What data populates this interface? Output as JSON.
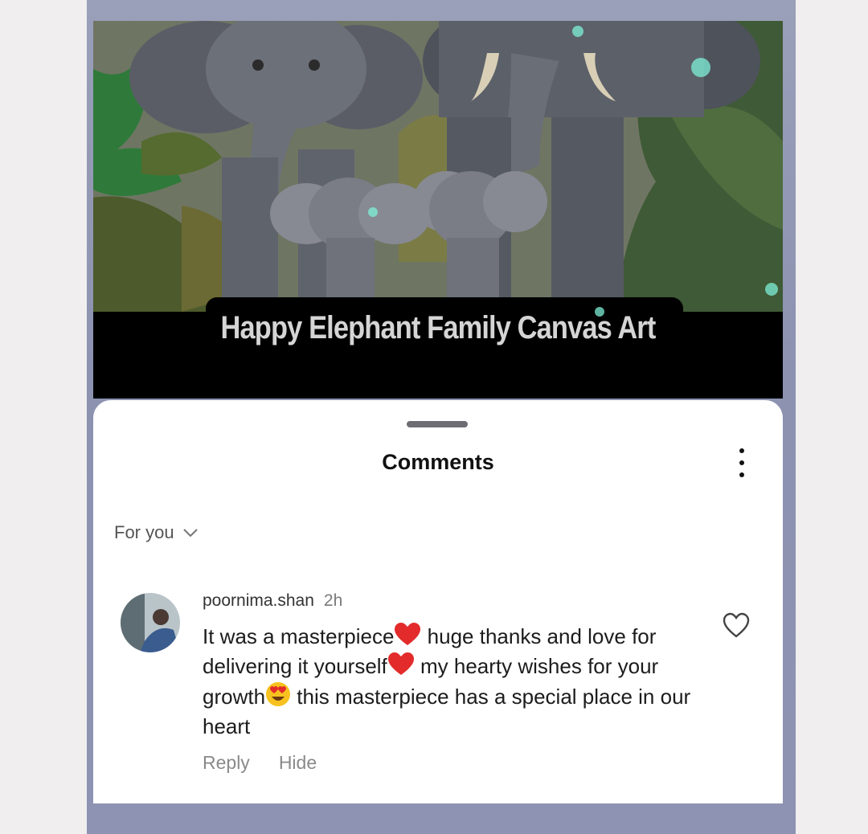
{
  "post": {
    "caption": "Happy Elephant Family Canvas Art"
  },
  "comments_sheet": {
    "title": "Comments",
    "filter_label": "For you",
    "comment": {
      "username": "poornima.shan",
      "time": "2h",
      "text_1": "It was a masterpiece",
      "text_2": " huge thanks and love for delivering it yourself",
      "text_3": " my hearty wishes for your growth",
      "text_4": " this masterpiece has a special place in our heart",
      "reply_label": "Reply",
      "hide_label": "Hide"
    }
  },
  "icons": {
    "more": "more-vertical-icon",
    "chevron": "chevron-down-icon",
    "like": "heart-outline-icon",
    "emoji_heart": "red-heart-emoji",
    "emoji_eyes": "heart-eyes-emoji"
  },
  "colors": {
    "sheet_bg": "#ffffff",
    "frame_bg": "#9aa0b9",
    "heart_red": "#e32b2b",
    "emoji_yellow": "#f7c21f"
  }
}
